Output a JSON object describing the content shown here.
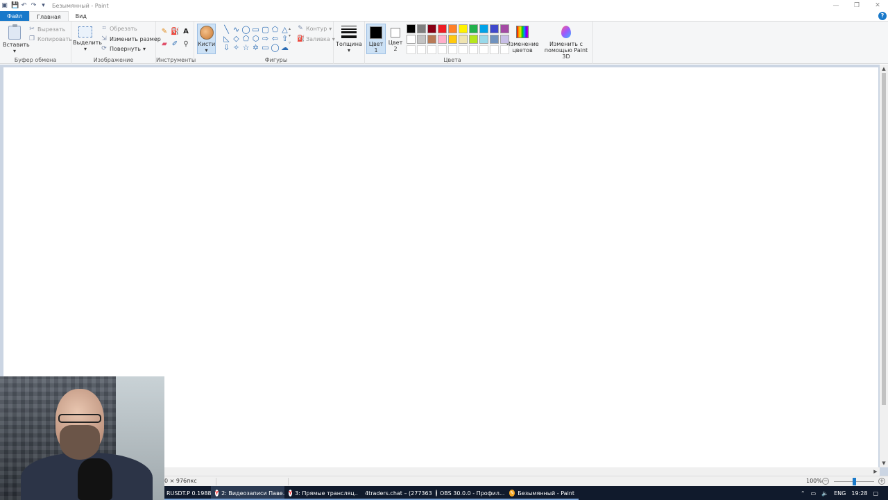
{
  "window": {
    "title": "Безымянный - Paint",
    "controls": [
      "—",
      "❐",
      "✕"
    ]
  },
  "tabs": [
    "Файл",
    "Главная",
    "Вид"
  ],
  "ribbon": {
    "clipboard": {
      "paste": "Вставить",
      "cut": "Вырезать",
      "copy": "Копировать",
      "label": "Буфер обмена"
    },
    "image": {
      "select": "Выделить",
      "crop": "Обрезать",
      "resize": "Изменить размер",
      "rotate": "Повернуть",
      "label": "Изображение"
    },
    "tools": {
      "label": "Инструменты"
    },
    "brushes": {
      "label": "Кисти"
    },
    "shapes": {
      "outline": "Контур",
      "fill": "Заливка",
      "label": "Фигуры"
    },
    "size": {
      "label": "Толщина"
    },
    "colors": {
      "color1": "Цвет 1",
      "color2": "Цвет 2",
      "edit": "Изменение цветов",
      "paint3d": "Изменить с помощью Paint 3D",
      "label": "Цвета",
      "color1_value": "#000000",
      "color2_value": "#ffffff",
      "palette": [
        "#000000",
        "#7f7f7f",
        "#880015",
        "#ed1c24",
        "#ff7f27",
        "#fff200",
        "#22b14c",
        "#00a2e8",
        "#3f48cc",
        "#a349a4",
        "#ffffff",
        "#c3c3c3",
        "#b97a57",
        "#ffaec9",
        "#ffc90e",
        "#efe4b0",
        "#b5e61d",
        "#99d9ea",
        "#7092be",
        "#c8bfe7",
        "",
        "",
        "",
        "",
        "",
        "",
        "",
        "",
        "",
        ""
      ]
    }
  },
  "status": {
    "canvas_size": "0 × 976пкс",
    "zoom": "100%",
    "zoom_level": 0.5
  },
  "taskbar": {
    "items": [
      {
        "label": "RUSDT.P 0.1988...",
        "icon": "chart-icon",
        "color": "#2a2e39"
      },
      {
        "label": "2: Видеозаписи Паве...",
        "icon": "yandex-icon",
        "color": "#ff3333",
        "active": true
      },
      {
        "label": "3: Прямые трансляц...",
        "icon": "yandex-icon",
        "color": "#ff3333"
      },
      {
        "label": "4traders.chat – (277363)",
        "icon": "chrome-icon",
        "color": "#e94235"
      },
      {
        "label": "OBS 30.0.0 - Профил...",
        "icon": "obs-icon",
        "color": "#444"
      },
      {
        "label": "Безымянный - Paint",
        "icon": "paint-icon",
        "color": "#f5a623"
      }
    ],
    "tray": {
      "lang": "ENG",
      "time": "19:28"
    }
  }
}
